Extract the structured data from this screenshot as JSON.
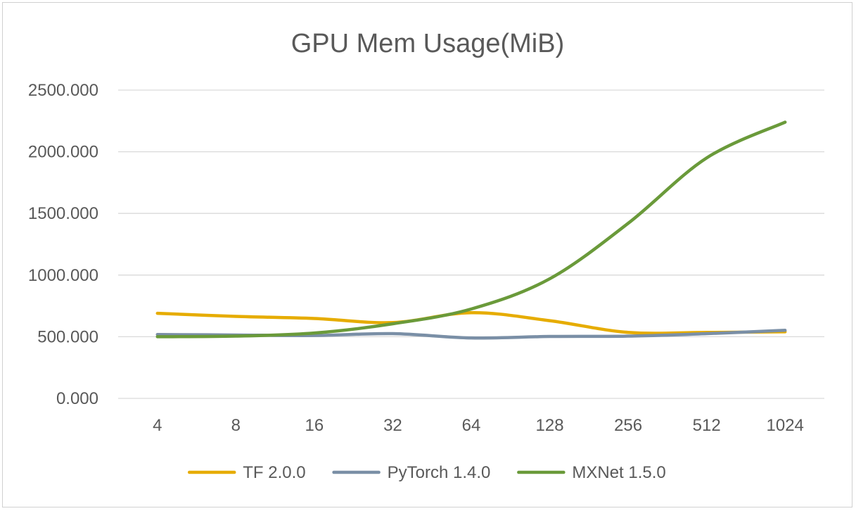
{
  "chart_data": {
    "type": "line",
    "title": "GPU Mem Usage(MiB)",
    "xlabel": "",
    "ylabel": "",
    "categories": [
      "4",
      "8",
      "16",
      "32",
      "64",
      "128",
      "256",
      "512",
      "1024"
    ],
    "ylim": [
      0,
      2500
    ],
    "yticks": [
      "0.000",
      "500.000",
      "1000.000",
      "1500.000",
      "2000.000",
      "2500.000"
    ],
    "grid": true,
    "smooth": true,
    "legend_position": "bottom",
    "series": [
      {
        "name": "TF 2.0.0",
        "color": "#E6AC00",
        "values": [
          690,
          665,
          648,
          615,
          695,
          630,
          535,
          535,
          540
        ]
      },
      {
        "name": "PyTorch 1.4.0",
        "color": "#7A8FA6",
        "values": [
          518,
          514,
          510,
          525,
          490,
          502,
          505,
          525,
          552
        ]
      },
      {
        "name": "MXNet 1.5.0",
        "color": "#6A9A3A",
        "values": [
          500,
          505,
          530,
          605,
          725,
          970,
          1420,
          1950,
          2240
        ]
      }
    ]
  }
}
